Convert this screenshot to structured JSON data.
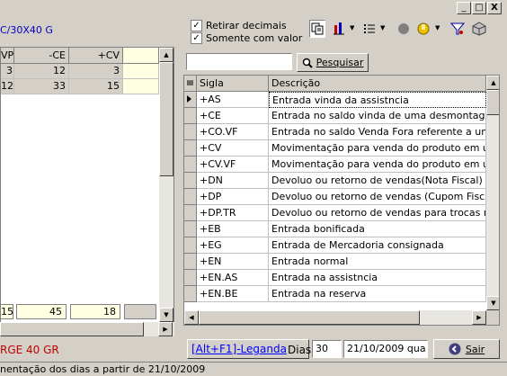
{
  "window": {
    "title_fragment": "C/30X40 G",
    "minimize_glyph": "_",
    "maximize_glyph": "□",
    "close_glyph": "X"
  },
  "options": {
    "retirar_decimais": "Retirar decimais",
    "somente_com_valor": "Somente com valor",
    "check_mark": "✓"
  },
  "toolbar": {
    "icons": [
      "copy-icon",
      "chart-icon",
      "list-icon",
      "circle-icon",
      "hand-icon",
      "filter-icon",
      "cube-icon"
    ]
  },
  "left_grid": {
    "headers": [
      "VP",
      "-CE",
      "+CV"
    ],
    "rows": [
      [
        "3",
        "12",
        "3"
      ],
      [
        "12",
        "33",
        "15"
      ]
    ],
    "totals": [
      "15",
      "45",
      "18"
    ]
  },
  "search": {
    "input_value": "",
    "button_label": "Pesquisar"
  },
  "right_grid": {
    "headers": [
      "Sigla",
      "Descrição"
    ],
    "rows": [
      [
        "+AS",
        "Entrada vinda da assistncia"
      ],
      [
        "+CE",
        "Entrada no saldo vinda de uma desmontagem de c"
      ],
      [
        "+CO.VF",
        "Entrada no saldo Venda Fora referente a uma sada"
      ],
      [
        "+CV",
        "Movimentação para venda do produto em uma ces"
      ],
      [
        "+CV.VF",
        "Movimentação para venda do produto em uma ces"
      ],
      [
        "+DN",
        "Devoluo ou retorno de vendas(Nota Fiscal) + % de"
      ],
      [
        "+DP",
        "Devoluo ou retorno de vendas (Cupom Fiscal) + %"
      ],
      [
        "+DP.TR",
        "Devoluo ou retorno de vendas para trocas mais pe"
      ],
      [
        "+EB",
        "Entrada bonificada"
      ],
      [
        "+EG",
        "Entrada de Mercadoria consignada"
      ],
      [
        "+EN",
        "Entrada normal"
      ],
      [
        "+EN.AS",
        "Entrada na assistncia"
      ],
      [
        "+EN.BE",
        "Entrada na reserva"
      ]
    ]
  },
  "bottom": {
    "left_label": "RGE 40 GR",
    "legend_link": "[Alt+F1]-Leganda",
    "dias_label": "Dias",
    "dias_value": "30",
    "date_value": "21/10/2009 qua",
    "exit_label": "Sair"
  },
  "status": {
    "text": "nentação dos dias a partir de 21/10/2009"
  },
  "colors": {
    "title_blue": "#0000c0",
    "left_label_red": "#c00000",
    "grid_yellow": "#ffffe1",
    "link_blue": "#0000ff"
  }
}
